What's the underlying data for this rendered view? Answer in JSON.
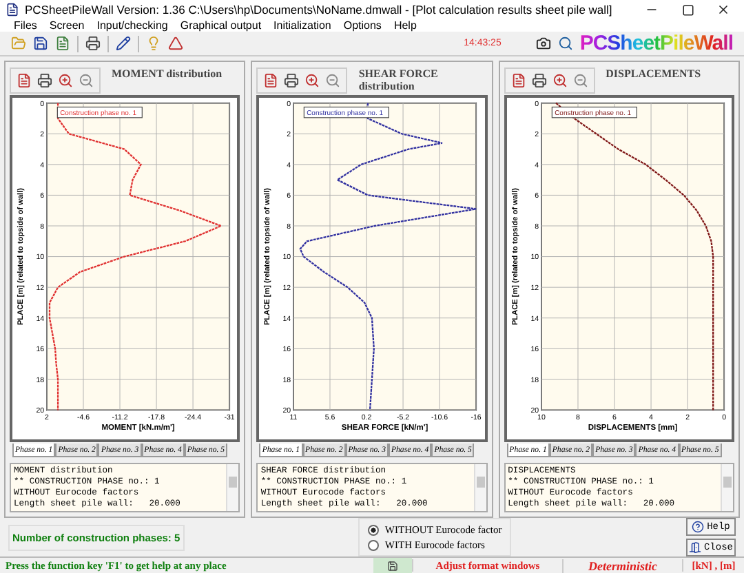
{
  "window": {
    "title": "PCSheetPileWall  Version: 1.36  C:\\Users\\hp\\Documents\\NoName.dmwall - [Plot calculation results sheet pile wall]"
  },
  "menu": [
    "Files",
    "Screen",
    "Input/checking",
    "Graphical output",
    "Initialization",
    "Options",
    "Help"
  ],
  "toolbar": {
    "clock": "14:43:25",
    "logo": "PCSheetPileWall"
  },
  "panels": [
    {
      "title": "MOMENT distribution",
      "chart_data": {
        "type": "line",
        "orientation": "horizontal",
        "xlabel": "MOMENT [kN.m/m']",
        "ylabel": "PLACE [m] (related to topside of wall)",
        "x": [
          0,
          1,
          2,
          3,
          4,
          5,
          6,
          7,
          8,
          9,
          10,
          11,
          12,
          13,
          14,
          15,
          16,
          17,
          18,
          19,
          20
        ],
        "xlim": [
          2,
          -31
        ],
        "ylim": [
          20,
          0
        ],
        "xticks": [
          2,
          -4.6,
          -11.2,
          -17.8,
          -24.4,
          -31
        ],
        "yticks": [
          0,
          2,
          4,
          6,
          8,
          10,
          12,
          14,
          16,
          18,
          20
        ],
        "grid": true,
        "series": [
          {
            "name": "Construction phase no. 1",
            "color": "#e03030",
            "line_style": "dotted",
            "values": [
              0,
              0,
              -2,
              -12,
              -15,
              -13.5,
              -13,
              -22,
              -29.5,
              -23,
              -12,
              -4,
              0,
              1.5,
              1.5,
              1,
              0.5,
              0.3,
              0,
              0,
              0
            ]
          }
        ]
      },
      "tabs": [
        {
          "label": "Phase no. 1",
          "selected": true
        },
        {
          "label": "Phase no. 2",
          "selected": false
        },
        {
          "label": "Phase no. 3",
          "selected": false
        },
        {
          "label": "Phase no. 4",
          "selected": false
        },
        {
          "label": "Phase no. 5",
          "selected": false
        }
      ],
      "report": [
        "MOMENT distribution",
        "** CONSTRUCTION PHASE no.: 1",
        "WITHOUT Eurocode factors",
        "Length sheet pile wall:   20.000"
      ]
    },
    {
      "title": "SHEAR FORCE distribution",
      "chart_data": {
        "type": "line",
        "orientation": "horizontal",
        "xlabel": "SHEAR FORCE [kN/m']",
        "ylabel": "PLACE [m] (related to topside of wall)",
        "x": [
          0,
          1,
          2,
          2.6,
          3,
          4,
          5,
          6,
          6.9,
          8,
          9,
          9.5,
          10,
          11,
          12,
          13,
          14,
          16,
          18,
          20
        ],
        "xlim": [
          11,
          -16
        ],
        "ylim": [
          20,
          0
        ],
        "xticks": [
          11,
          5.6,
          0.2,
          -5.2,
          -10.6,
          -16
        ],
        "yticks": [
          0,
          2,
          4,
          6,
          8,
          10,
          12,
          14,
          16,
          18,
          20
        ],
        "grid": true,
        "series": [
          {
            "name": "Construction phase no. 1",
            "color": "#3030a0",
            "line_style": "dotted",
            "values": [
              0,
              0,
              -5,
              -11,
              -6,
              1,
              4.5,
              0,
              -16,
              -1,
              9,
              10,
              9.5,
              6.5,
              3,
              0.5,
              -0.6,
              -0.9,
              -0.6,
              -0.3
            ]
          }
        ]
      },
      "tabs": [
        {
          "label": "Phase no. 1",
          "selected": true
        },
        {
          "label": "Phase no. 2",
          "selected": false
        },
        {
          "label": "Phase no. 3",
          "selected": false
        },
        {
          "label": "Phase no. 4",
          "selected": false
        },
        {
          "label": "Phase no. 5",
          "selected": false
        }
      ],
      "report": [
        "SHEAR FORCE distribution",
        "** CONSTRUCTION PHASE no.: 1",
        "WITHOUT Eurocode factors",
        "Length sheet pile wall:   20.000"
      ]
    },
    {
      "title": "DISPLACEMENTS",
      "chart_data": {
        "type": "line",
        "orientation": "horizontal",
        "xlabel": "DISPLACEMENTS [mm]",
        "ylabel": "PLACE [m] (related to topside of wall)",
        "x": [
          0,
          1,
          2,
          3,
          4,
          5,
          6,
          7,
          8,
          9,
          10,
          12,
          14,
          16,
          18,
          20
        ],
        "xlim": [
          10,
          0
        ],
        "ylim": [
          20,
          0
        ],
        "xticks": [
          10,
          8,
          6,
          4,
          2,
          0
        ],
        "yticks": [
          0,
          2,
          4,
          6,
          8,
          10,
          12,
          14,
          16,
          18,
          20
        ],
        "grid": true,
        "series": [
          {
            "name": "Construction phase no. 1",
            "color": "#801818",
            "line_style": "dotted",
            "values": [
              9.2,
              8.2,
              7,
              5.8,
              4.3,
              3.2,
              2.2,
              1.5,
              1,
              0.7,
              0.6,
              0.6,
              0.6,
              0.6,
              0.6,
              0.6
            ]
          }
        ]
      },
      "tabs": [
        {
          "label": "Phase no. 1",
          "selected": true
        },
        {
          "label": "Phase no. 2",
          "selected": false
        },
        {
          "label": "Phase no. 3",
          "selected": false
        },
        {
          "label": "Phase no. 4",
          "selected": false
        },
        {
          "label": "Phase no. 5",
          "selected": false
        }
      ],
      "report": [
        "DISPLACEMENTS",
        "** CONSTRUCTION PHASE no.: 1",
        "WITHOUT Eurocode factors",
        "Length sheet pile wall:   20.000"
      ]
    }
  ],
  "phase_count": "Number of construction phases: 5",
  "factor_options": [
    {
      "label": "WITHOUT Eurocode factor",
      "selected": true
    },
    {
      "label": "WITH Eurocode factors",
      "selected": false
    }
  ],
  "buttons": [
    {
      "kind": "help",
      "label": "Help"
    },
    {
      "kind": "close",
      "label": "Close"
    }
  ],
  "status_bar": {
    "hint": "Press the function key 'F1' to get help at any place",
    "format": "Adjust format windows",
    "mode": "Deterministic",
    "units": "[kN] , [m]"
  }
}
